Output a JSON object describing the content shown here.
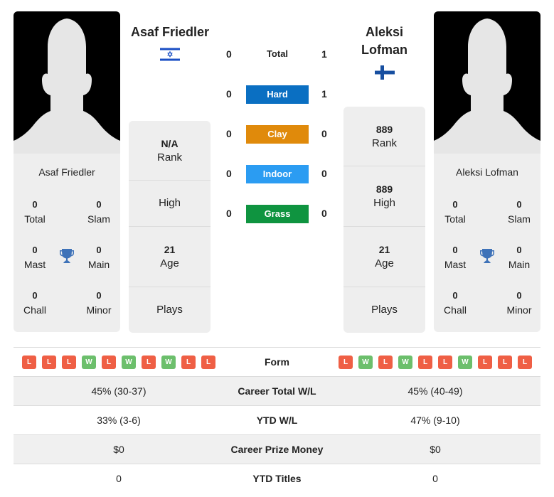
{
  "colors": {
    "hard": "#0a6fc2",
    "clay": "#e08a0b",
    "indoor": "#2b9cf2",
    "grass": "#0f9440",
    "win": "#6cbf6c",
    "loss": "#ef5f45",
    "trophy": "#3e72b8"
  },
  "player1": {
    "name": "Asaf Friedler",
    "flag": "israel-flag",
    "card": {
      "name": "Asaf Friedler",
      "total": "0",
      "total_label": "Total",
      "slam": "0",
      "slam_label": "Slam",
      "mast": "0",
      "mast_label": "Mast",
      "main": "0",
      "main_label": "Main",
      "chall": "0",
      "chall_label": "Chall",
      "minor": "0",
      "minor_label": "Minor"
    },
    "info": {
      "rank": "N/A",
      "rank_label": "Rank",
      "high_label": "High",
      "age": "21",
      "age_label": "Age",
      "plays_label": "Plays"
    },
    "form": [
      "L",
      "L",
      "L",
      "W",
      "L",
      "W",
      "L",
      "W",
      "L",
      "L"
    ]
  },
  "player2": {
    "name": "Aleksi Lofman",
    "flag": "finland-flag",
    "card": {
      "name": "Aleksi Lofman",
      "total": "0",
      "total_label": "Total",
      "slam": "0",
      "slam_label": "Slam",
      "mast": "0",
      "mast_label": "Mast",
      "main": "0",
      "main_label": "Main",
      "chall": "0",
      "chall_label": "Chall",
      "minor": "0",
      "minor_label": "Minor"
    },
    "info": {
      "rank": "889",
      "rank_label": "Rank",
      "high": "889",
      "high_label": "High",
      "age": "21",
      "age_label": "Age",
      "plays_label": "Plays"
    },
    "form": [
      "L",
      "W",
      "L",
      "W",
      "L",
      "L",
      "W",
      "L",
      "L",
      "L"
    ]
  },
  "h2h": {
    "total": {
      "label": "Total",
      "p1": "0",
      "p2": "1"
    },
    "hard": {
      "label": "Hard",
      "p1": "0",
      "p2": "1"
    },
    "clay": {
      "label": "Clay",
      "p1": "0",
      "p2": "0"
    },
    "indoor": {
      "label": "Indoor",
      "p1": "0",
      "p2": "0"
    },
    "grass": {
      "label": "Grass",
      "p1": "0",
      "p2": "0"
    }
  },
  "table": {
    "form_label": "Form",
    "rows": [
      {
        "label": "Career Total W/L",
        "p1": "45% (30-37)",
        "p2": "45% (40-49)"
      },
      {
        "label": "YTD W/L",
        "p1": "33% (3-6)",
        "p2": "47% (9-10)"
      },
      {
        "label": "Career Prize Money",
        "p1": "$0",
        "p2": "$0"
      },
      {
        "label": "YTD Titles",
        "p1": "0",
        "p2": "0"
      }
    ]
  }
}
